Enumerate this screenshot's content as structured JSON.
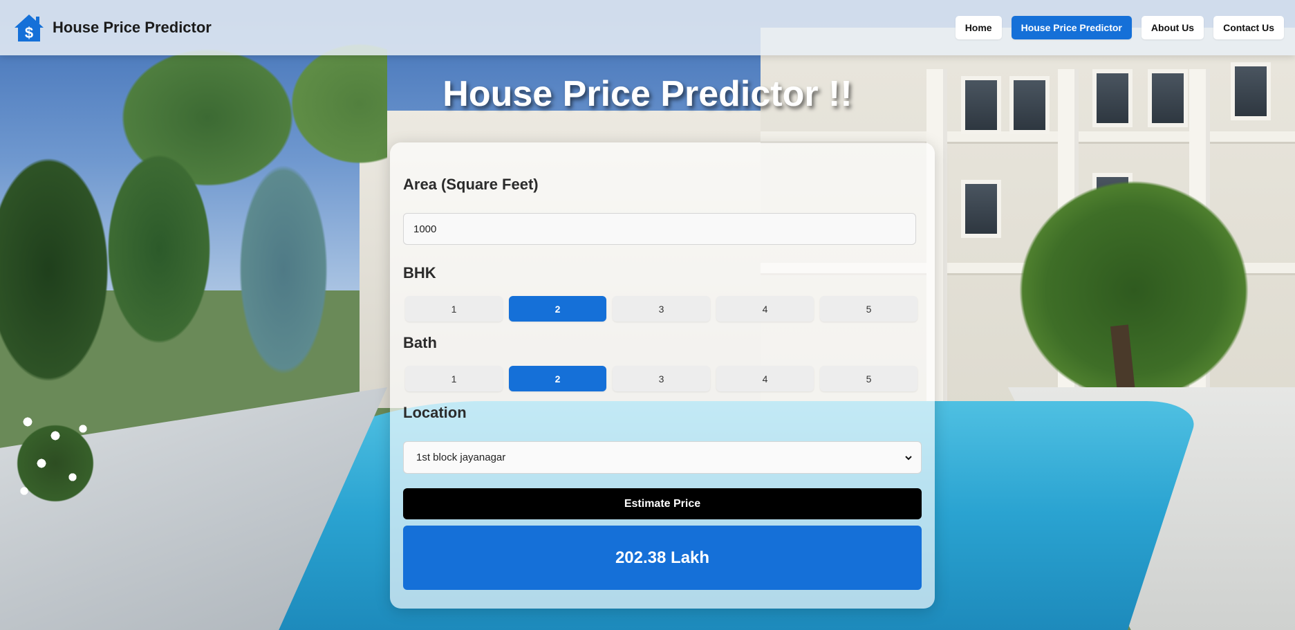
{
  "app": {
    "title": "House Price Predictor"
  },
  "nav": {
    "items": [
      {
        "label": "Home",
        "active": false
      },
      {
        "label": "House Price Predictor",
        "active": true
      },
      {
        "label": "About Us",
        "active": false
      },
      {
        "label": "Contact Us",
        "active": false
      }
    ]
  },
  "main": {
    "heading": "House Price Predictor !!"
  },
  "form": {
    "area": {
      "label": "Area (Square Feet)",
      "value": "1000"
    },
    "bhk": {
      "label": "BHK",
      "options": [
        "1",
        "2",
        "3",
        "4",
        "5"
      ],
      "selected": "2"
    },
    "bath": {
      "label": "Bath",
      "options": [
        "1",
        "2",
        "3",
        "4",
        "5"
      ],
      "selected": "2"
    },
    "location": {
      "label": "Location",
      "selected": "1st block jayanagar"
    },
    "submit_label": "Estimate Price",
    "result": "202.38 Lakh"
  },
  "icons": {
    "logo": "house-dollar-icon",
    "select_arrow": "chevron-down-icon"
  },
  "colors": {
    "accent": "#1570d8",
    "button_dark": "#000000"
  }
}
